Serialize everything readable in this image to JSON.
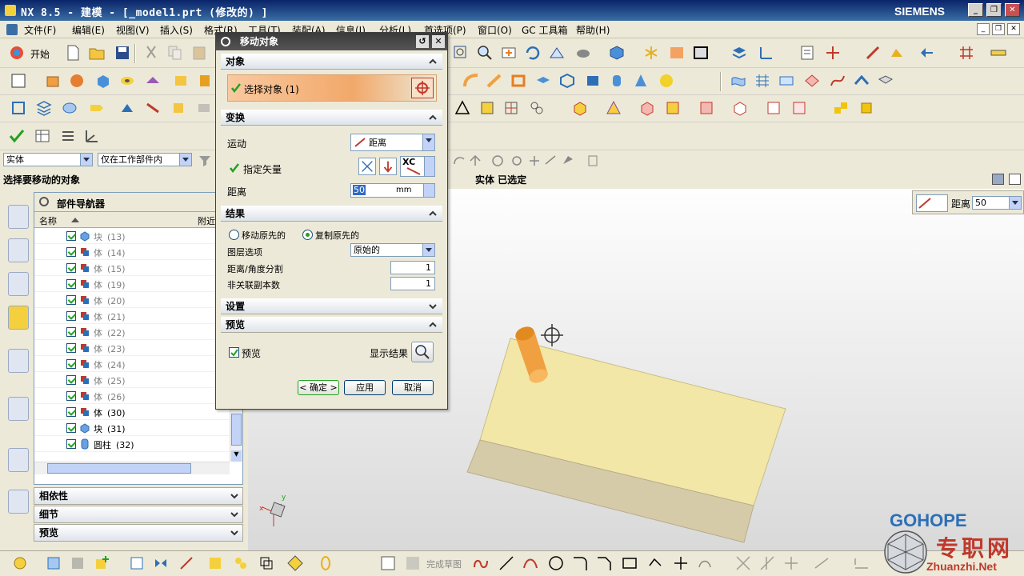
{
  "window": {
    "title": "NX 8.5 - 建模 - [_model1.prt  (修改的) ]",
    "brand": "SIEMENS",
    "buttons": [
      "_",
      "❐",
      "✕"
    ]
  },
  "menubar": {
    "items": [
      "文件(F)",
      "编辑(E)",
      "视图(V)",
      "插入(S)",
      "格式(R)",
      "工具(T)",
      "装配(A)",
      "信息(I)",
      "分析(L)",
      "首选项(P)",
      "窗口(O)",
      "GC 工具箱",
      "帮助(H)"
    ],
    "mdi_buttons": [
      "_",
      "❐",
      "✕"
    ]
  },
  "toolbar": {
    "start_label": "开始"
  },
  "filter": {
    "type_value": "实体",
    "scope_value": "仅在工作部件内"
  },
  "cue": {
    "prompt": "选择要移动的对象",
    "status": "实体 已选定"
  },
  "navigator": {
    "title": "部件导航器",
    "col_name": "名称",
    "col_attach": "附近",
    "rows": [
      {
        "label": "块",
        "num": "(13)",
        "icon": "block",
        "active": false
      },
      {
        "label": "体",
        "num": "(14)",
        "icon": "body",
        "active": false
      },
      {
        "label": "体",
        "num": "(15)",
        "icon": "body",
        "active": false
      },
      {
        "label": "体",
        "num": "(19)",
        "icon": "body",
        "active": false
      },
      {
        "label": "体",
        "num": "(20)",
        "icon": "body",
        "active": false
      },
      {
        "label": "体",
        "num": "(21)",
        "icon": "body",
        "active": false
      },
      {
        "label": "体",
        "num": "(22)",
        "icon": "body",
        "active": false
      },
      {
        "label": "体",
        "num": "(23)",
        "icon": "body",
        "active": false
      },
      {
        "label": "体",
        "num": "(24)",
        "icon": "body",
        "active": false
      },
      {
        "label": "体",
        "num": "(25)",
        "icon": "body",
        "active": false
      },
      {
        "label": "体",
        "num": "(26)",
        "icon": "body",
        "active": false
      },
      {
        "label": "体",
        "num": "(30)",
        "icon": "body",
        "active": true
      },
      {
        "label": "块",
        "num": "(31)",
        "icon": "block",
        "active": true
      },
      {
        "label": "圆柱",
        "num": "(32)",
        "icon": "cylinder",
        "active": true
      }
    ],
    "panels": [
      "相依性",
      "细节",
      "预览"
    ]
  },
  "dialog": {
    "title": "移动对象",
    "sec_object": "对象",
    "select_object": "选择对象 (1)",
    "sec_transform": "变换",
    "motion_label": "运动",
    "motion_value": "距离",
    "vector_label": "指定矢量",
    "vector_value": "XC",
    "distance_label": "距离",
    "distance_value": "50",
    "distance_unit": "mm",
    "sec_result": "结果",
    "move_original": "移动原先的",
    "copy_original": "复制原先的",
    "layer_label": "图层选项",
    "layer_value": "原始的",
    "divisions_label": "距离/角度分割",
    "divisions_value": "1",
    "copies_label": "非关联副本数",
    "copies_value": "1",
    "sec_settings": "设置",
    "sec_preview": "预览",
    "preview_label": "预览",
    "show_result_label": "显示结果",
    "ok_label": "< 确定 >",
    "apply_label": "应用",
    "cancel_label": "取消"
  },
  "onscreen": {
    "distance_label": "距离",
    "distance_value": "50"
  },
  "bottombar": {
    "sketch_label": "完成草图"
  },
  "watermark": {
    "brand": "GOHOPE",
    "cn": "专职网",
    "url": "Zhuanzhi.Net"
  },
  "colors": {
    "accent": "#0a246a",
    "block_top": "#f2e7a6",
    "block_side": "#d6cba9",
    "cylinder": "#f0a040",
    "check": "#21a121"
  }
}
